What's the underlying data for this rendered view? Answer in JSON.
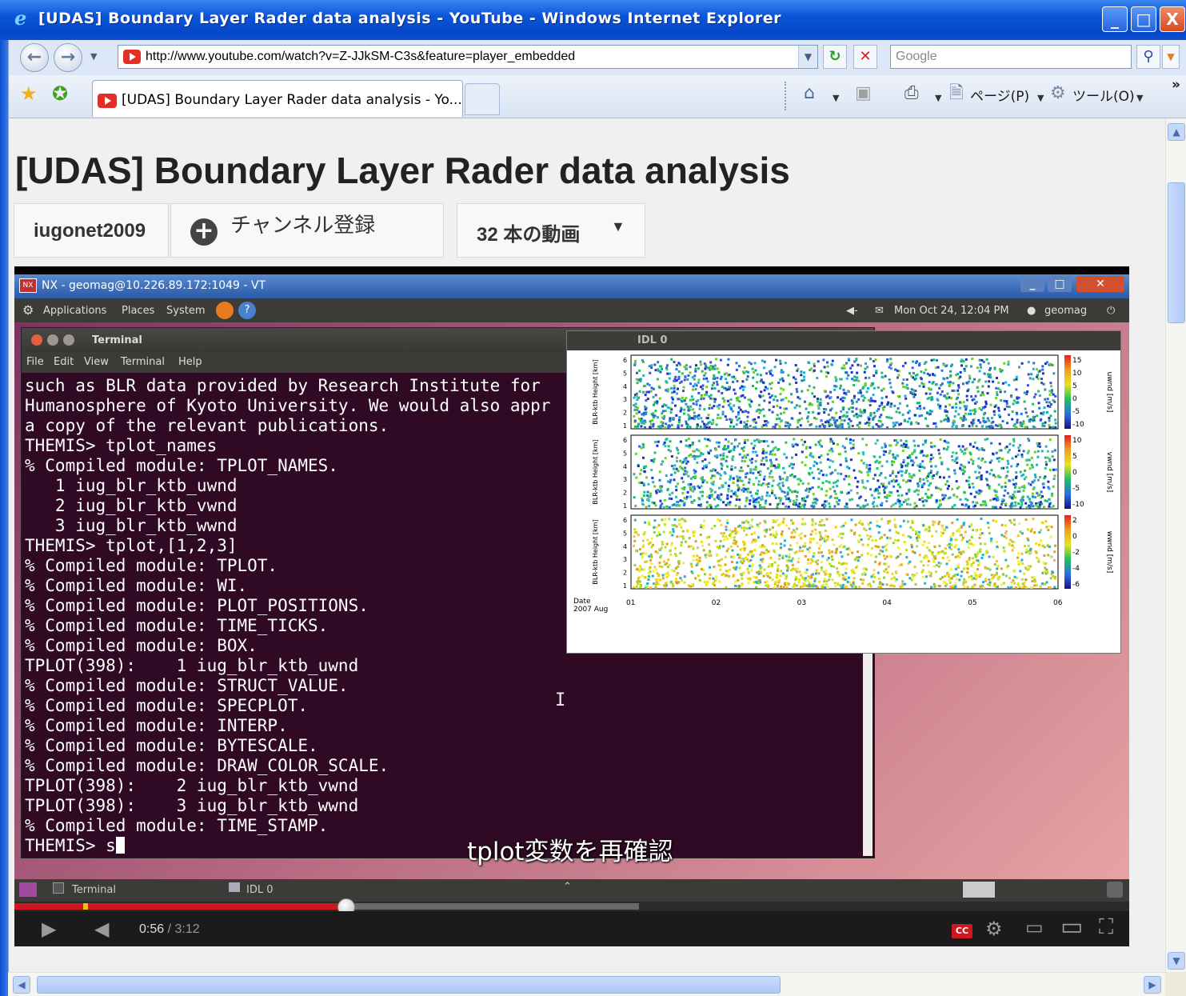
{
  "window": {
    "title": "[UDAS]  Boundary Layer Rader data analysis - YouTube - Windows Internet Explorer",
    "minimize": "_",
    "maximize": "□",
    "close": "X"
  },
  "navbar": {
    "url": "http://www.youtube.com/watch?v=Z-JJkSM-C3s&feature=player_embedded",
    "search_placeholder": "Google"
  },
  "tab": {
    "label": "[UDAS]  Boundary Layer Rader data analysis - Yo..."
  },
  "commands": {
    "page": "ページ(P)",
    "tools": "ツール(O)",
    "overflow": "»"
  },
  "page": {
    "title": "[UDAS]  Boundary Layer Rader data analysis",
    "channel": "iugonet2009",
    "subscribe": "チャンネル登録",
    "videos": "32 本の動画"
  },
  "video": {
    "nx_title": "NX - geomag@10.226.89.172:1049 - VT",
    "gnome_menus": [
      "Applications",
      "Places",
      "System"
    ],
    "clock": "Mon Oct 24, 12:04 PM",
    "user": "geomag",
    "terminal": {
      "title": "Terminal",
      "menus": [
        "File",
        "Edit",
        "View",
        "Terminal",
        "Help"
      ],
      "lines": [
        "such as BLR data provided by Research Institute for",
        "Humanosphere of Kyoto University. We would also appr",
        "a copy of the relevant publications.",
        "THEMIS> tplot_names",
        "% Compiled module: TPLOT_NAMES.",
        "   1 iug_blr_ktb_uwnd",
        "   2 iug_blr_ktb_vwnd",
        "   3 iug_blr_ktb_wwnd",
        "THEMIS> tplot,[1,2,3]",
        "% Compiled module: TPLOT.",
        "% Compiled module: WI.",
        "% Compiled module: PLOT_POSITIONS.",
        "% Compiled module: TIME_TICKS.",
        "% Compiled module: BOX.",
        "TPLOT(398):    1 iug_blr_ktb_uwnd",
        "% Compiled module: STRUCT_VALUE.",
        "% Compiled module: SPECPLOT.",
        "% Compiled module: INTERP.",
        "% Compiled module: BYTESCALE.",
        "% Compiled module: DRAW_COLOR_SCALE.",
        "TPLOT(398):    2 iug_blr_ktb_vwnd",
        "TPLOT(398):    3 iug_blr_ktb_wwnd",
        "% Compiled module: TIME_STAMP."
      ],
      "prompt": "THEMIS> s"
    },
    "idl": {
      "title": "IDL 0",
      "panels": [
        {
          "ylabel": "BLR-ktb Height [km]",
          "cbar_label": "uwnd [m/s]",
          "cbar_ticks": [
            "15",
            "10",
            "5",
            "0",
            "-5",
            "-10"
          ]
        },
        {
          "ylabel": "BLR-ktb Height [km]",
          "cbar_label": "vwnd [m/s]",
          "cbar_ticks": [
            "10",
            "5",
            "0",
            "-5",
            "-10"
          ]
        },
        {
          "ylabel": "BLR-ktb Height [km]",
          "cbar_label": "wwnd [m/s]",
          "cbar_ticks": [
            "2",
            "0",
            "-2",
            "-4",
            "-6"
          ]
        }
      ],
      "y_ticks": [
        "1",
        "2",
        "3",
        "4",
        "5",
        "6"
      ],
      "x_ticks": [
        "01",
        "02",
        "03",
        "04",
        "05",
        "06"
      ],
      "date_label": "Date",
      "date_value": "2007 Aug"
    },
    "taskbar": {
      "terminal": "Terminal",
      "idl": "IDL 0"
    },
    "caption": "tplot変数を再確認",
    "time_current": "0:56",
    "time_sep": " / ",
    "time_total": "3:12",
    "played_fraction": 0.298,
    "loaded_fraction": 0.56,
    "cc": "CC"
  }
}
